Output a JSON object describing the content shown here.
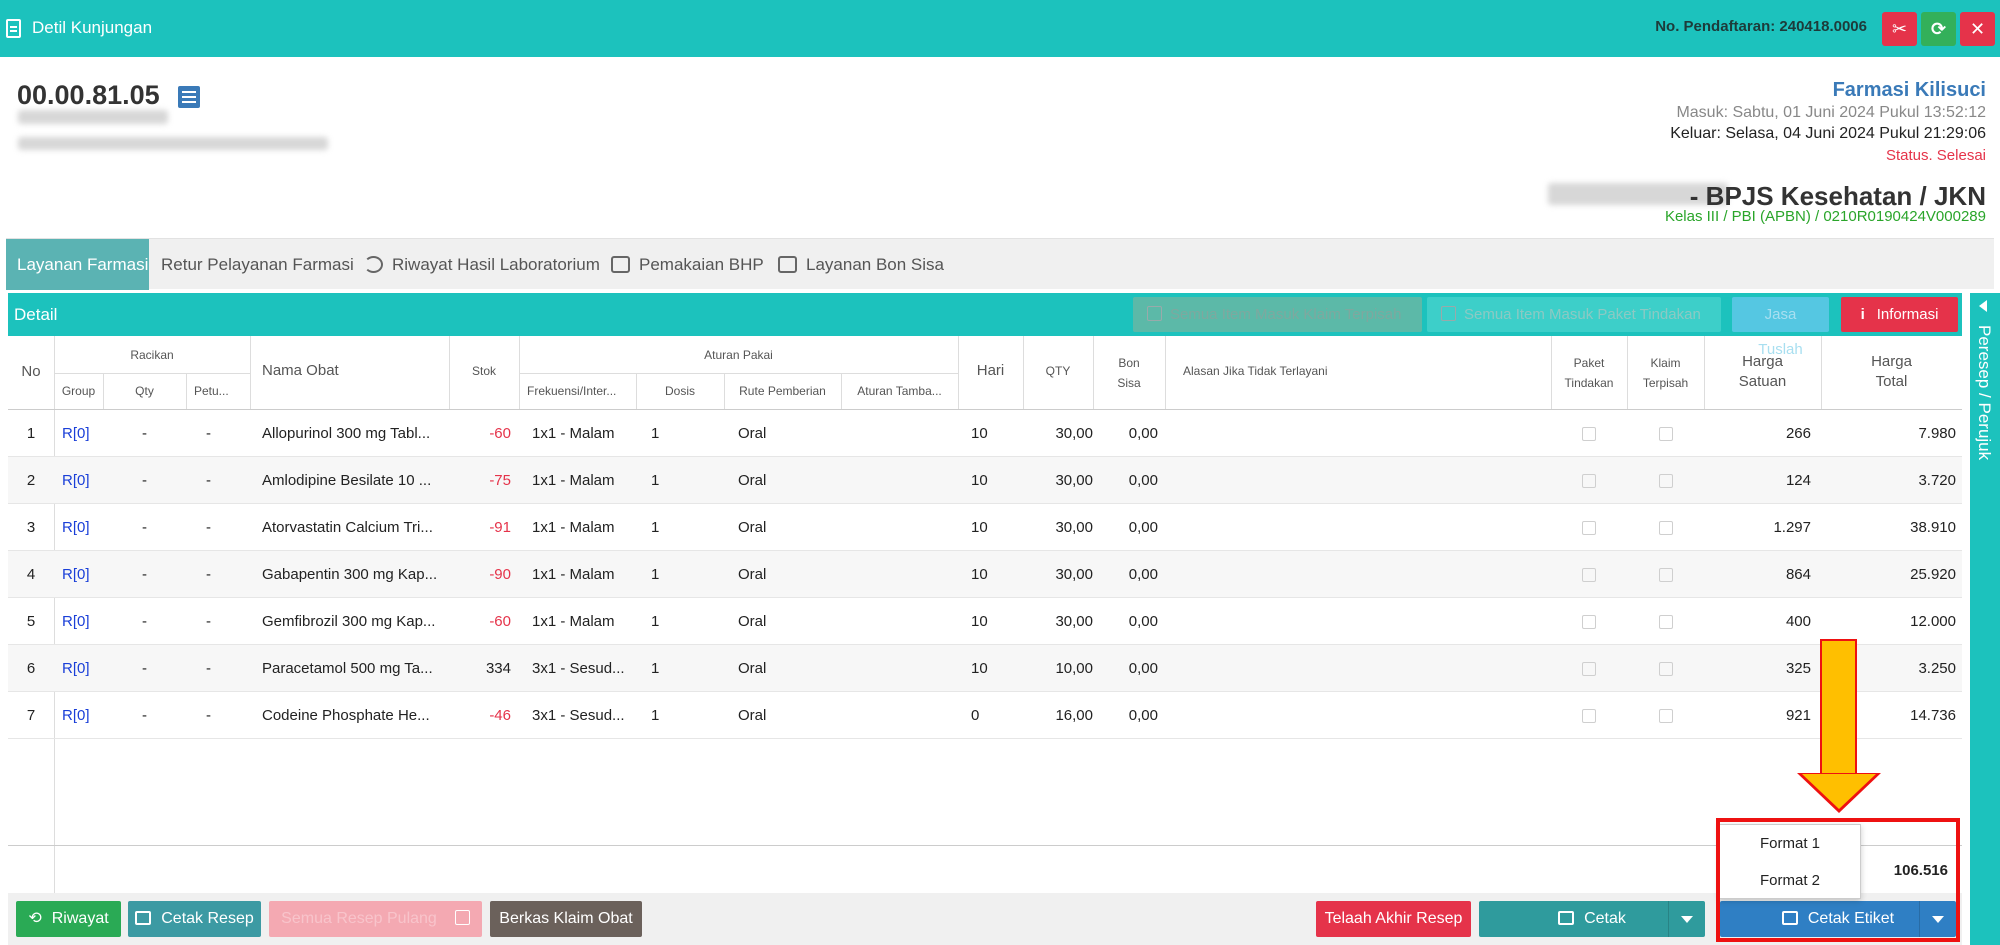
{
  "titlebar": {
    "title": "Detil Kunjungan",
    "registration": "No. Pendaftaran: 240418.0006",
    "buttons": {
      "tools": "✂",
      "refresh": "⟳",
      "close": "✕"
    }
  },
  "patient": {
    "code": "00.00.81.05",
    "farmasi": "Farmasi Kilisuci",
    "masuk": "Masuk: Sabtu, 01 Juni 2024 Pukul 13:52:12",
    "keluar": "Keluar: Selasa, 04 Juni 2024 Pukul 21:29:06",
    "status": "Status. Selesai",
    "insurance": " - BPJS Kesehatan / JKN",
    "kelas": "Kelas III / PBI (APBN) / 0210R0190424V000289"
  },
  "tabs": [
    {
      "label": "Layanan Farmasi"
    },
    {
      "label": "Retur Pelayanan Farmasi"
    },
    {
      "label": "Riwayat Hasil Laboratorium"
    },
    {
      "label": "Pemakaian BHP"
    },
    {
      "label": "Layanan Bon Sisa"
    }
  ],
  "detail": {
    "title": "Detail",
    "btn_klaim": "Semua Item Masuk Klaim Terpisah",
    "btn_paket": "Semua Item Masuk Paket Tindakan",
    "btn_jasa": "Jasa Tuslah",
    "btn_info": "Informasi"
  },
  "side_tab": "Peresep / Perujuk",
  "table": {
    "headers": {
      "no": "No",
      "racikan": "Racikan",
      "group": "Group",
      "qty": "Qty",
      "petu": "Petu...",
      "nama": "Nama Obat",
      "stok": "Stok",
      "aturan": "Aturan Pakai",
      "frek": "Frekuensi/Inter...",
      "dosis": "Dosis",
      "rute": "Rute Pemberian",
      "tambahan": "Aturan Tamba...",
      "hari": "Hari",
      "qty2": "QTY",
      "bon1": "Bon",
      "bon2": "Sisa",
      "alasan": "Alasan Jika Tidak Terlayani",
      "paket1": "Paket",
      "paket2": "Tindakan",
      "klaim1": "Klaim",
      "klaim2": "Terpisah",
      "hs1": "Harga",
      "hs2": "Satuan",
      "ht1": "Harga",
      "ht2": "Total"
    },
    "rows": [
      {
        "no": "1",
        "group": "R[0]",
        "qty": "-",
        "petu": "-",
        "nama": "Allopurinol 300 mg Tabl...",
        "stok": "-60",
        "frek": "1x1 - Malam",
        "dosis": "1",
        "rute": "Oral",
        "hari": "10",
        "qty2": "30,00",
        "bon": "0,00",
        "harga_satuan": "266",
        "harga_total": "7.980"
      },
      {
        "no": "2",
        "group": "R[0]",
        "qty": "-",
        "petu": "-",
        "nama": "Amlodipine Besilate 10 ...",
        "stok": "-75",
        "frek": "1x1 - Malam",
        "dosis": "1",
        "rute": "Oral",
        "hari": "10",
        "qty2": "30,00",
        "bon": "0,00",
        "harga_satuan": "124",
        "harga_total": "3.720"
      },
      {
        "no": "3",
        "group": "R[0]",
        "qty": "-",
        "petu": "-",
        "nama": "Atorvastatin Calcium Tri...",
        "stok": "-91",
        "frek": "1x1 - Malam",
        "dosis": "1",
        "rute": "Oral",
        "hari": "10",
        "qty2": "30,00",
        "bon": "0,00",
        "harga_satuan": "1.297",
        "harga_total": "38.910"
      },
      {
        "no": "4",
        "group": "R[0]",
        "qty": "-",
        "petu": "-",
        "nama": "Gabapentin 300 mg Kap...",
        "stok": "-90",
        "frek": "1x1 - Malam",
        "dosis": "1",
        "rute": "Oral",
        "hari": "10",
        "qty2": "30,00",
        "bon": "0,00",
        "harga_satuan": "864",
        "harga_total": "25.920"
      },
      {
        "no": "5",
        "group": "R[0]",
        "qty": "-",
        "petu": "-",
        "nama": "Gemfibrozil 300 mg Kap...",
        "stok": "-60",
        "frek": "1x1 - Malam",
        "dosis": "1",
        "rute": "Oral",
        "hari": "10",
        "qty2": "30,00",
        "bon": "0,00",
        "harga_satuan": "400",
        "harga_total": "12.000"
      },
      {
        "no": "6",
        "group": "R[0]",
        "qty": "-",
        "petu": "-",
        "nama": "Paracetamol 500 mg Ta...",
        "stok": "334",
        "frek": "3x1 - Sesud...",
        "dosis": "1",
        "rute": "Oral",
        "hari": "10",
        "qty2": "10,00",
        "bon": "0,00",
        "harga_satuan": "325",
        "harga_total": "3.250"
      },
      {
        "no": "7",
        "group": "R[0]",
        "qty": "-",
        "petu": "-",
        "nama": "Codeine Phosphate He...",
        "stok": "-46",
        "frek": "3x1 - Sesud...",
        "dosis": "1",
        "rute": "Oral",
        "hari": "0",
        "qty2": "16,00",
        "bon": "0,00",
        "harga_satuan": "921",
        "harga_total": "14.736"
      }
    ],
    "grand_total": "106.516"
  },
  "bottom": {
    "riwayat": "Riwayat",
    "cetak_resep": "Cetak Resep",
    "disabled_btn": "Semua Resep Pulang",
    "berkas": "Berkas Klaim Obat",
    "telaah": "Telaah Akhir Resep",
    "cetak": "Cetak",
    "cetak_etiket": "Cetak Etiket"
  },
  "dropdown": {
    "format1": "Format 1",
    "format2": "Format 2"
  },
  "colors": {
    "teal": "#1cc2bd",
    "red": "#e5334a",
    "green": "#33b05a",
    "blue": "#3a7ab8"
  }
}
